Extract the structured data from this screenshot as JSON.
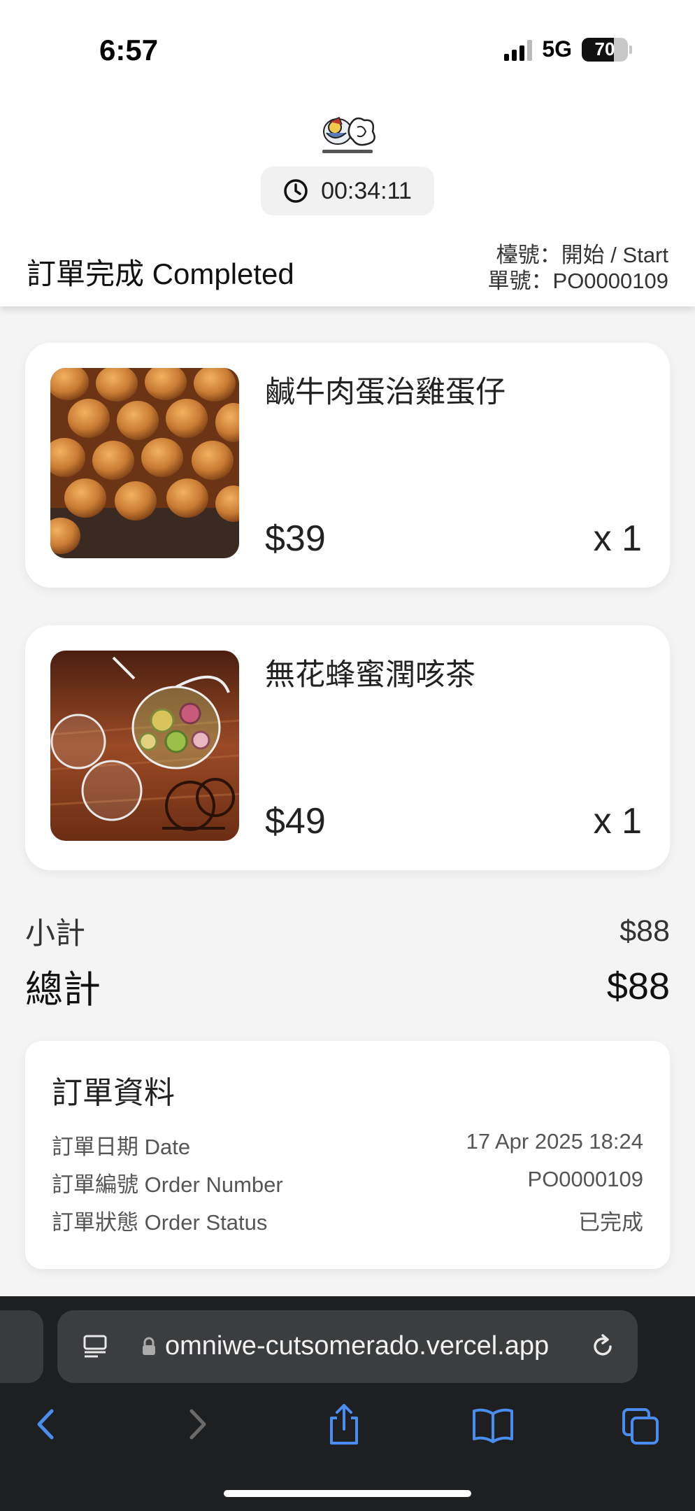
{
  "status_bar": {
    "time": "6:57",
    "network": "5G",
    "battery": "70",
    "battery_level": 0.7
  },
  "header": {
    "timer": "00:34:11",
    "status_title": "訂單完成 Completed",
    "table_line": "檯號：開始 / Start",
    "order_line": "單號：PO0000109"
  },
  "items": [
    {
      "name": "鹹牛肉蛋治雞蛋仔",
      "price": "$39",
      "qty": "x 1"
    },
    {
      "name": "無花蜂蜜潤咳茶",
      "price": "$49",
      "qty": "x 1"
    }
  ],
  "totals": {
    "subtotal_label": "小計",
    "subtotal_value": "$88",
    "total_label": "總計",
    "total_value": "$88"
  },
  "order_info": {
    "title": "訂單資料",
    "date_label": "訂單日期 Date",
    "date_value": "17 Apr 2025 18:24",
    "number_label": "訂單編號 Order Number",
    "number_value": "PO0000109",
    "status_label": "訂單狀態 Order Status",
    "status_value": "已完成"
  },
  "browser": {
    "url": "omniwe-cutsomerado.vercel.app"
  },
  "colors": {
    "browser_bg": "#1e1f21",
    "browser_accent": "#4a8cf0",
    "card_bg": "#ffffff"
  }
}
